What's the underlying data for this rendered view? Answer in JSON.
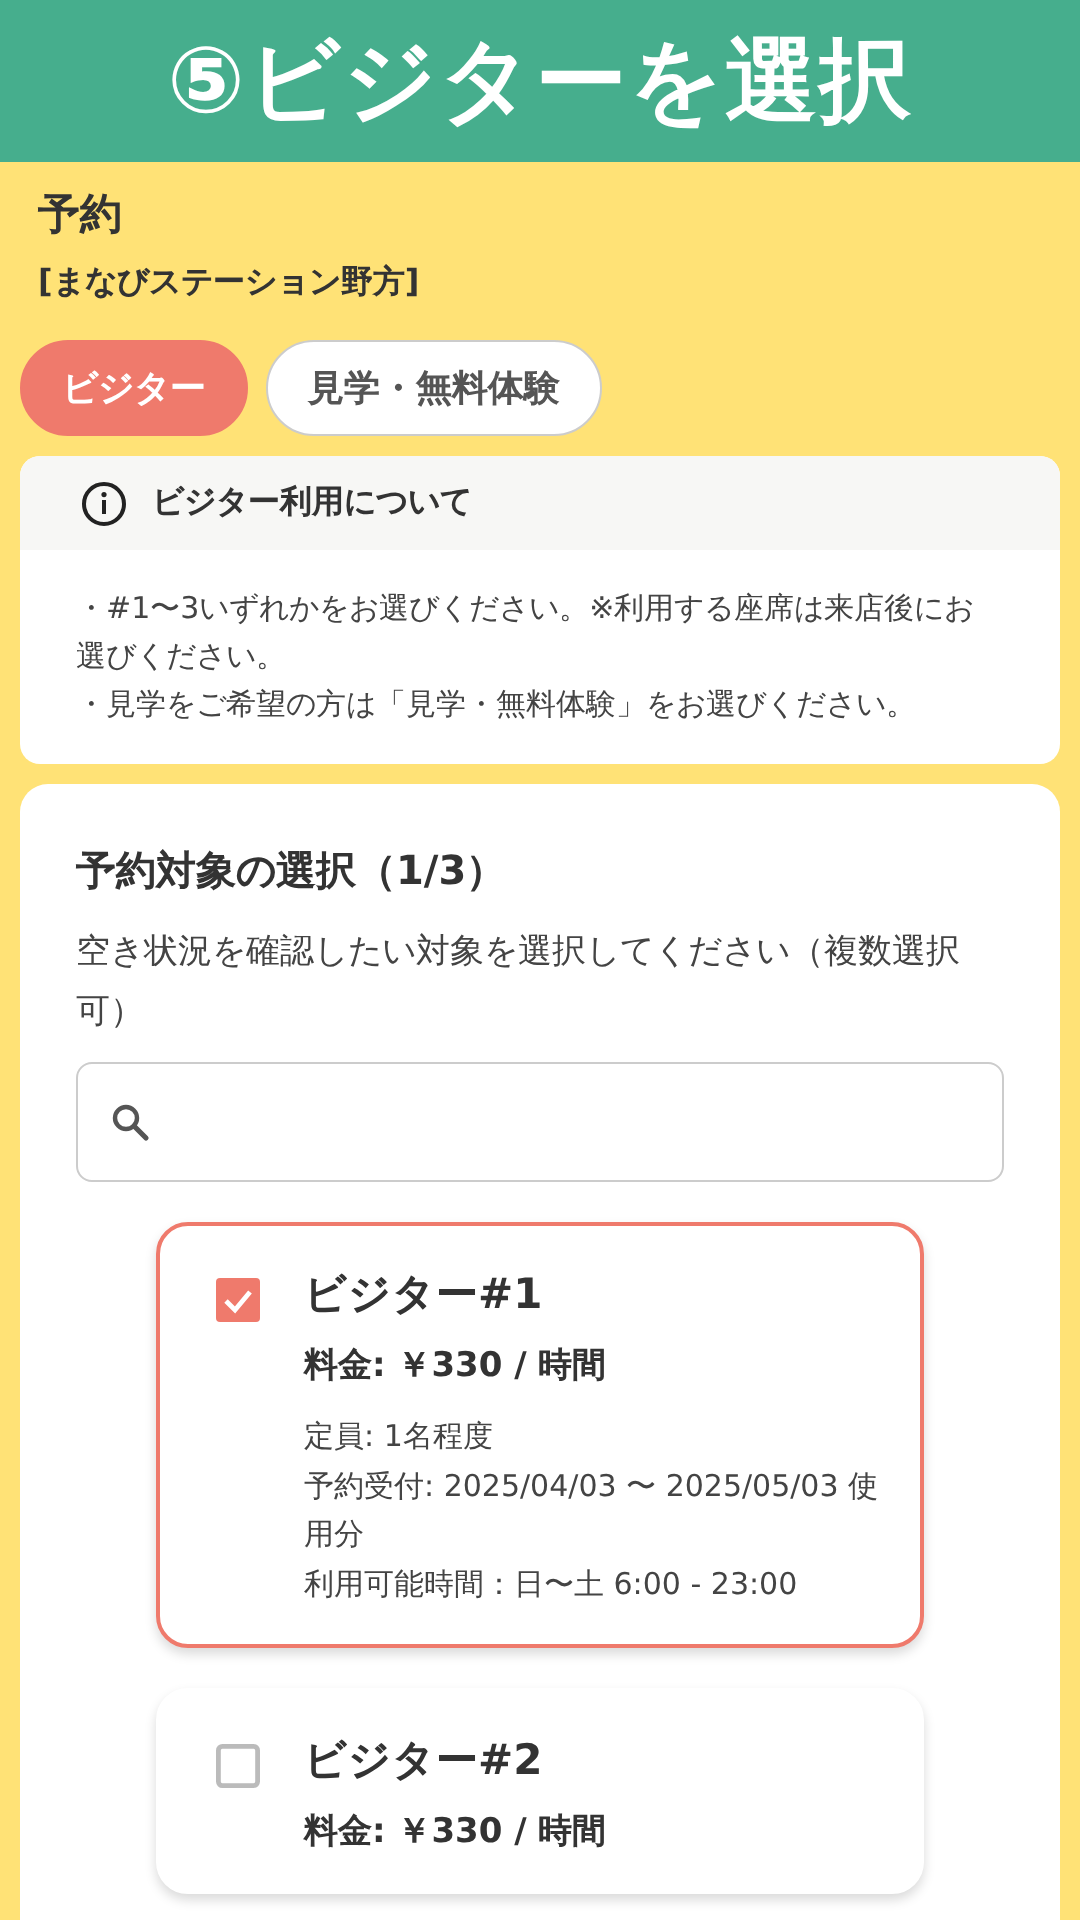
{
  "banner": {
    "title": "⑤ビジターを選択"
  },
  "header": {
    "title": "予約",
    "location": "[まなびステーション野方]"
  },
  "tabs": [
    {
      "label": "ビジター",
      "selected": true
    },
    {
      "label": "見学・無料体験",
      "selected": false
    }
  ],
  "notice": {
    "title": "ビジター利用について",
    "lines": [
      "・#1〜3いずれかをお選びください。※利用する座席は来店後にお選びください。",
      "・見学をご希望の方は「見学・無料体験」をお選びください。"
    ]
  },
  "selection": {
    "title": "予約対象の選択（1/3）",
    "description": "空き状況を確認したい対象を選択してください（複数選択可）",
    "items": [
      {
        "name": "ビジター#1",
        "price": "料金: ￥330 / 時間",
        "checked": true,
        "details": [
          "定員: 1名程度",
          "予約受付: 2025/04/03 〜 2025/05/03 使用分",
          "利用可能時間：日〜土 6:00 - 23:00"
        ]
      },
      {
        "name": "ビジター#2",
        "price": "料金: ￥330 / 時間",
        "checked": false
      }
    ]
  }
}
